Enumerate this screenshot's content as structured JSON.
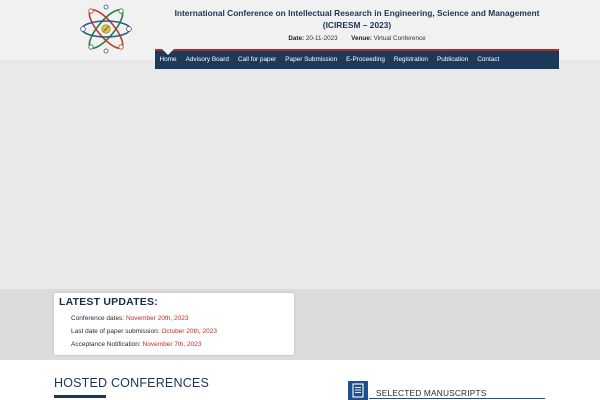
{
  "header": {
    "title_line1": "International Conference on Intellectual Research in Engineering, Science and Management",
    "title_line2": "(ICIRESM – 2023)",
    "date_label": "Date",
    "date_value": "20-11-2023",
    "venue_label": "Venue",
    "venue_value": "Virtual Conference",
    "logo_icon": "atom-logo-icon"
  },
  "nav": {
    "items": [
      {
        "label": "Home",
        "active": true
      },
      {
        "label": "Advisory Board"
      },
      {
        "label": "Call for paper"
      },
      {
        "label": "Paper Submission"
      },
      {
        "label": "E-Proceeding"
      },
      {
        "label": "Registration"
      },
      {
        "label": "Publication"
      },
      {
        "label": "Contact"
      }
    ]
  },
  "updates": {
    "title": "LATEST UPDATES:",
    "items": [
      {
        "label": "Conference dates:",
        "date": "November 20th, 2023"
      },
      {
        "label": "Last date of paper submission:",
        "date": "October 20th, 2023"
      },
      {
        "label": "Acceptance Notification:",
        "date": "November 7th, 2023"
      }
    ]
  },
  "sections": {
    "hosted_title": "HOSTED CONFERENCES",
    "manuscripts_title": "SELECTED MANUSCRIPTS",
    "manuscripts_icon": "document-icon"
  },
  "colors": {
    "navy": "#1e3a5a",
    "accent_red": "#c22a2a",
    "blue": "#1e4f8a"
  }
}
